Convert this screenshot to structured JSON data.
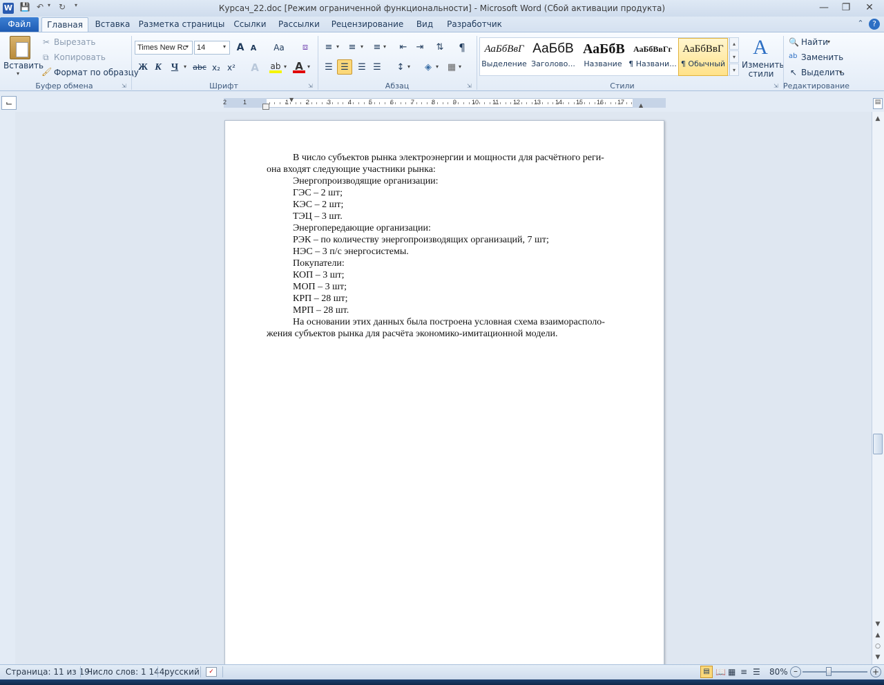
{
  "window": {
    "title": "Курсач_22.doc [Режим ограниченной функциональности]  -  Microsoft Word (Сбой активации продукта)",
    "app_icon": "W"
  },
  "tabs": [
    "Файл",
    "Главная",
    "Вставка",
    "Разметка страницы",
    "Ссылки",
    "Рассылки",
    "Рецензирование",
    "Вид",
    "Разработчик"
  ],
  "clipboard": {
    "paste": "Вставить",
    "cut": "Вырезать",
    "copy": "Копировать",
    "format_painter": "Формат по образцу",
    "label": "Буфер обмена"
  },
  "font": {
    "name": "Times New Rc",
    "size": "14",
    "label": "Шрифт",
    "bold": "Ж",
    "italic": "К",
    "underline": "Ч",
    "strike": "abc",
    "sub": "x₂",
    "sup": "x²",
    "case": "Aa",
    "grow": "A",
    "shrink": "A"
  },
  "paragraph": {
    "label": "Абзац",
    "pilcrow": "¶"
  },
  "styles": {
    "label": "Стили",
    "items": [
      {
        "sample": "АаБбВвГ",
        "name": "Выделение"
      },
      {
        "sample": "АаБбВ",
        "name": "Заголово..."
      },
      {
        "sample": "АаБбВ",
        "name": "Название"
      },
      {
        "sample": "АаБбВвГг",
        "name": "¶ Названи..."
      },
      {
        "sample": "АаБбВвГ",
        "name": "¶ Обычный"
      }
    ],
    "change": "Изменить стили"
  },
  "editing": {
    "label": "Редактирование",
    "find": "Найти",
    "replace": "Заменить",
    "select": "Выделить"
  },
  "ruler": {
    "numbers": [
      "2",
      "1",
      "1",
      "2",
      "3",
      "4",
      "5",
      "6",
      "7",
      "8",
      "9",
      "10",
      "11",
      "12",
      "13",
      "14",
      "15",
      "16",
      "17"
    ]
  },
  "document": {
    "lines": [
      {
        "text": "В число субъектов рынка электроэнергии и мощности для расчётного реги-",
        "indent": true
      },
      {
        "text": "она входят следующие участники рынка:",
        "indent": false
      },
      {
        "text": "Энергопроизводящие организации:",
        "indent": true
      },
      {
        "text": "ГЭС – 2 шт;",
        "indent": true
      },
      {
        "text": "КЭС – 2 шт;",
        "indent": true
      },
      {
        "text": "ТЭЦ – 3 шт.",
        "indent": true
      },
      {
        "text": "Энергопередающие организации:",
        "indent": true
      },
      {
        "text": "РЭК – по количеству энергопроизводящих организаций, 7 шт;",
        "indent": true
      },
      {
        "text": "НЭС – 3 п/с энергосистемы.",
        "indent": true
      },
      {
        "text": "Покупатели:",
        "indent": true
      },
      {
        "text": "КОП – 3 шт;",
        "indent": true
      },
      {
        "text": "МОП – 3 шт;",
        "indent": true
      },
      {
        "text": "КРП – 28 шт;",
        "indent": true
      },
      {
        "text": "МРП – 28 шт.",
        "indent": true
      },
      {
        "text": "На основании этих данных была построена условная схема взаиморасполо-",
        "indent": true
      },
      {
        "text": "жения субъектов рынка для расчёта экономико-имитационной модели.",
        "indent": false
      }
    ]
  },
  "status": {
    "page": "Страница: 11 из 19",
    "words": "Число слов: 1 144",
    "language": "русский",
    "zoom": "80%"
  }
}
